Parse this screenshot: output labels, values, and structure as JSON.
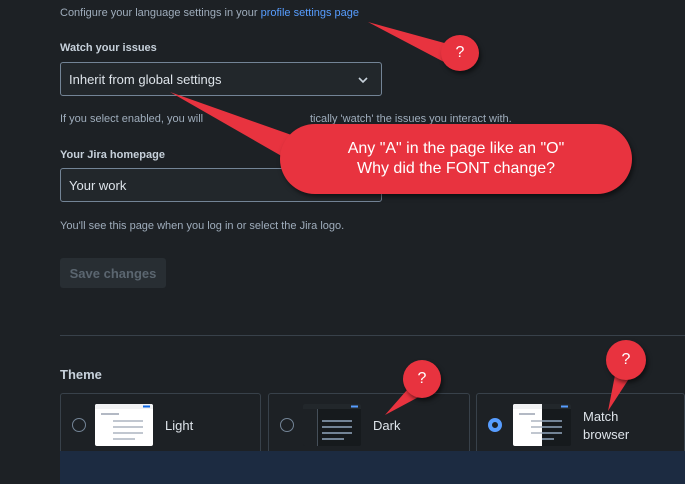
{
  "language": {
    "hint_prefix": "Configure your language settings in your",
    "link_text": "profile settings page"
  },
  "watch": {
    "label": "Watch your issues",
    "value": "Inherit from global settings",
    "hint_start": "If you select enabled, you will",
    "hint_end": "tically 'watch' the issues you interact with."
  },
  "homepage": {
    "label": "Your Jira homepage",
    "value": "Your work",
    "hint": "You'll see this page when you log in or select the Jira logo."
  },
  "save_label": "Save changes",
  "theme": {
    "heading": "Theme",
    "options": [
      {
        "label": "Light",
        "selected": false
      },
      {
        "label": "Dark",
        "selected": false
      },
      {
        "label_line1": "Match",
        "label_line2": "browser",
        "selected": true
      }
    ]
  },
  "annotations": {
    "bubble_mark": "?",
    "comment_line1": "Any \"A\" in the page like an \"O\"",
    "comment_line2": "Why did the FONT change?"
  },
  "colors": {
    "background": "#1d2125",
    "accent": "#579dff",
    "annotation": "#e8333f"
  }
}
